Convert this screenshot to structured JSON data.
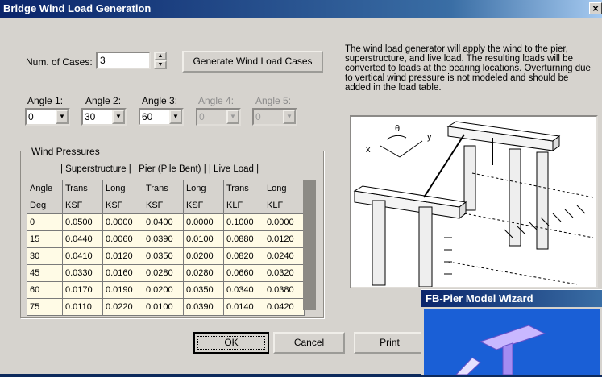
{
  "window": {
    "title": "Bridge Wind Load Generation",
    "close_glyph": "×"
  },
  "num_cases": {
    "label": "Num. of Cases:",
    "value": "3"
  },
  "generate_button": "Generate Wind Load Cases",
  "description": "The wind load generator will apply the wind to the pier, superstructure, and live load. The resulting loads will be converted to loads at the bearing locations. Overturning due to vertical wind pressure is not modeled and should be added in the load table.",
  "angles": [
    {
      "label": "Angle 1:",
      "value": "0",
      "enabled": true
    },
    {
      "label": "Angle 2:",
      "value": "30",
      "enabled": true
    },
    {
      "label": "Angle 3:",
      "value": "60",
      "enabled": true
    },
    {
      "label": "Angle 4:",
      "value": "0",
      "enabled": false
    },
    {
      "label": "Angle 5:",
      "value": "0",
      "enabled": false
    }
  ],
  "wind_pressures": {
    "group_label": "Wind Pressures",
    "section_header": "| Superstructure |  | Pier (Pile Bent) |   | Live Load |",
    "header_row1": [
      "Angle",
      "Trans",
      "Long",
      "Trans",
      "Long",
      "Trans",
      "Long"
    ],
    "header_row2": [
      "Deg",
      "KSF",
      "KSF",
      "KSF",
      "KSF",
      "KLF",
      "KLF"
    ],
    "rows": [
      [
        "0",
        "0.0500",
        "0.0000",
        "0.0400",
        "0.0000",
        "0.1000",
        "0.0000"
      ],
      [
        "15",
        "0.0440",
        "0.0060",
        "0.0390",
        "0.0100",
        "0.0880",
        "0.0120"
      ],
      [
        "30",
        "0.0410",
        "0.0120",
        "0.0350",
        "0.0200",
        "0.0820",
        "0.0240"
      ],
      [
        "45",
        "0.0330",
        "0.0160",
        "0.0280",
        "0.0280",
        "0.0660",
        "0.0320"
      ],
      [
        "60",
        "0.0170",
        "0.0190",
        "0.0200",
        "0.0350",
        "0.0340",
        "0.0380"
      ],
      [
        "75",
        "0.0110",
        "0.0220",
        "0.0100",
        "0.0390",
        "0.0140",
        "0.0420"
      ]
    ]
  },
  "buttons": {
    "ok": "OK",
    "cancel": "Cancel",
    "print": "Print"
  },
  "diagram_labels": {
    "x": "x",
    "theta": "θ",
    "y": "y"
  },
  "wizard": {
    "title": "FB-Pier Model Wizard"
  }
}
